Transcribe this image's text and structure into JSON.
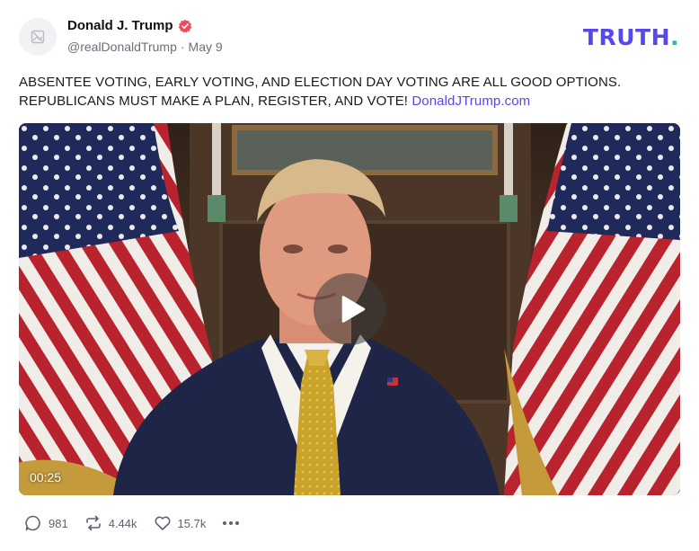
{
  "author": {
    "name": "Donald J. Trump",
    "handle": "@realDonaldTrump",
    "separator": "·",
    "date": "May 9"
  },
  "logo": {
    "text": "TRUTH",
    "period": ".",
    "brand_color": "#5448ee",
    "accent_color": "#17c3b2"
  },
  "post": {
    "line1": "ABSENTEE VOTING, EARLY VOTING, AND ELECTION DAY VOTING ARE ALL GOOD OPTIONS.",
    "line2": "REPUBLICANS MUST MAKE A PLAN, REGISTER, AND VOTE!",
    "link": "DonaldJTrump.com"
  },
  "video": {
    "duration": "00:25"
  },
  "actions": {
    "replies": "981",
    "retruths": "4.44k",
    "likes": "15.7k"
  },
  "icons": {
    "avatar": "image-placeholder-icon",
    "verified": "verified-badge-icon",
    "play": "play-icon",
    "reply": "comment-icon",
    "retruth": "repost-icon",
    "like": "heart-icon",
    "more": "more-dots-icon"
  }
}
